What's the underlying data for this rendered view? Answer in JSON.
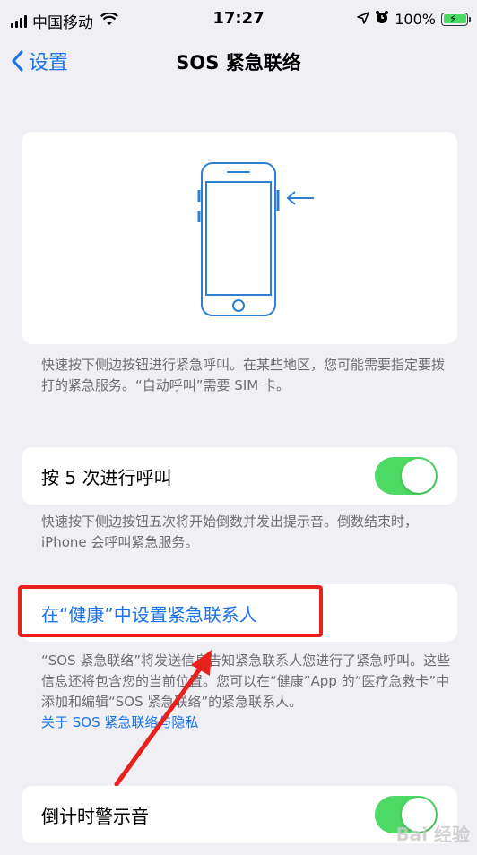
{
  "status": {
    "carrier": "中国移动",
    "time": "17:27",
    "battery": "100%"
  },
  "nav": {
    "back_label": "设置",
    "title": "SOS 紧急联络"
  },
  "sections": {
    "intro_note": "快速按下侧边按钮进行紧急呼叫。在某些地区，您可能需要指定要拨打的紧急服务。“自动呼叫”需要 SIM 卡。",
    "press5_label": "按 5 次进行呼叫",
    "press5_note": "快速按下侧边按钮五次将开始倒数并发出提示音。倒数结束时，iPhone 会呼叫紧急服务。",
    "health_link": "在“健康”中设置紧急联系人",
    "health_note": "“SOS 紧急联络”将发送信息告知紧急联系人您进行了紧急呼叫。这些信息还将包含您的当前位置。您可以在“健康”App 的“医疗急救卡”中添加和编辑“SOS 紧急联络”的紧急联系人。",
    "privacy_link": "关于 SOS 紧急联络与隐私",
    "countdown_label": "倒计时警示音"
  },
  "toggles": {
    "press5": true,
    "countdown": true
  },
  "watermark": "Bai 经验",
  "colors": {
    "accent": "#1a73e8",
    "toggle_on": "#4cd964",
    "highlight": "#e8211d"
  }
}
